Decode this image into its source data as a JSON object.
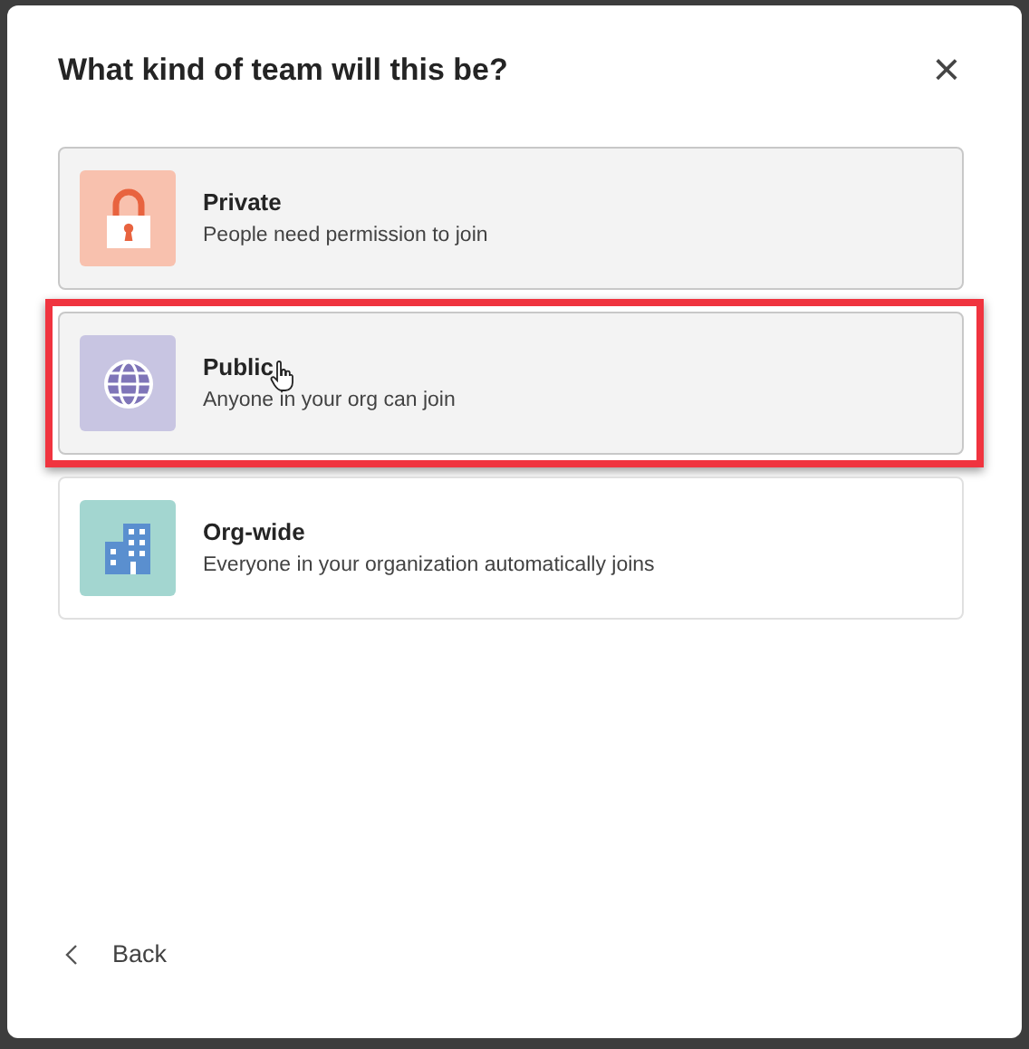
{
  "dialog": {
    "title": "What kind of team will this be?",
    "close": "×"
  },
  "options": [
    {
      "kind": "lock",
      "title": "Private",
      "description": "People need permission to join",
      "highlighted": true,
      "annotated": false,
      "cursor": false,
      "color": "#f8c1ae"
    },
    {
      "kind": "globe",
      "title": "Public",
      "description": "Anyone in your org can join",
      "highlighted": true,
      "annotated": true,
      "cursor": true,
      "color": "#c8c5e2"
    },
    {
      "kind": "building",
      "title": "Org-wide",
      "description": "Everyone in your organization automatically joins",
      "highlighted": false,
      "annotated": false,
      "cursor": false,
      "color": "#a3d6d0"
    }
  ],
  "back": {
    "label": "Back"
  }
}
